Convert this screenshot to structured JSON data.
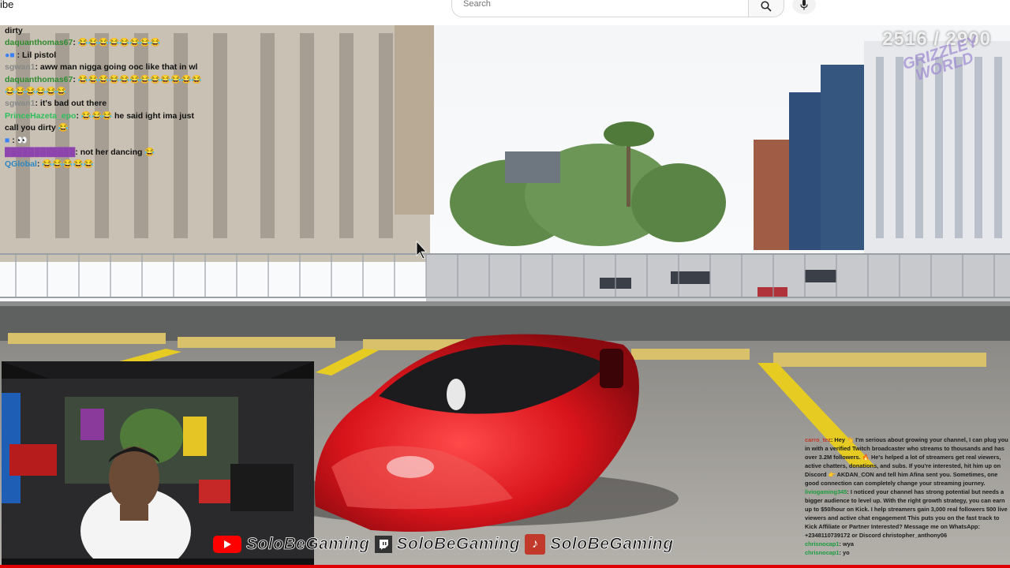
{
  "header": {
    "brand_text": "ibe",
    "search_placeholder": "Search",
    "search_icon": "search-icon",
    "mic_icon": "mic-icon"
  },
  "overlay": {
    "counter": "2516 / 2900",
    "watermark": "GRIZZLEY WORLD"
  },
  "chat": [
    {
      "user": "",
      "text": "dirty",
      "color": "#111111"
    },
    {
      "user": "daquanthomas67",
      "text": ": 😂😂😂😂😂😂😂😂",
      "color": "#2e8b2e"
    },
    {
      "user": "",
      "text": ": Lil pistol",
      "color": "#c0392b"
    },
    {
      "user": "sgwan1",
      "text": ": aww man nigga going ooc like that in wl",
      "color": "#888888"
    },
    {
      "user": "daquanthomas67",
      "text": ": 😂😂😂😂😂😂😂😂😂😂😂😂😂😂😂😂😂😂",
      "color": "#2e8b2e"
    },
    {
      "user": "sgwan1",
      "text": ": it's bad out there",
      "color": "#888888"
    },
    {
      "user": "PrinceHazeta_epo",
      "text": ": 😂😂😂 he said ight ima just call you dirty 😂",
      "color": "#2ebf5a"
    },
    {
      "user": "",
      "text": ": 👀",
      "color": "#c0392b"
    },
    {
      "user": "",
      "text": ": not her dancing 😂",
      "color": "#8e44ad"
    },
    {
      "user": "QGlobal",
      "text": ": 😂😂😂😂😂",
      "color": "#2e86c1"
    }
  ],
  "socials": {
    "youtube": "SoloBeGaming",
    "twitch": "SoloBeGaming",
    "tiktok": "SoloBeGaming"
  },
  "right_chat": [
    {
      "user": "carro_tez",
      "text": ": Hey 👋 I'm serious about growing your channel, I can plug you in with a verified Twitch broadcaster who streams to thousands and has over 3.2M followers. 🔥 He's helped a lot of streamers get real viewers, active chatters, donations, and subs. If you're interested, hit him up on Discord 👉 AKDAN_CON and tell him Afina sent you. Sometimes, one good connection can completely change your streaming journey.",
      "color": "#c0392b"
    },
    {
      "user": "liviogaming345",
      "text": ": I noticed your channel has strong potential but needs a bigger audience to level up. With the right growth strategy, you can earn up to $50/hour on Kick. I help streamers gain 3,000 real followers 500 live viewers and active chat engagement This puts you on the fast track to Kick Affiliate or Partner Interested? Message me on WhatsApp: +2348110739172 or Discord christopher_anthony06",
      "color": "#1a9c3e"
    },
    {
      "user": "chrisnocap1",
      "text": ": wya",
      "color": "#1a9c3e"
    },
    {
      "user": "chrisnocap1",
      "text": ": yo",
      "color": "#1a9c3e"
    }
  ]
}
